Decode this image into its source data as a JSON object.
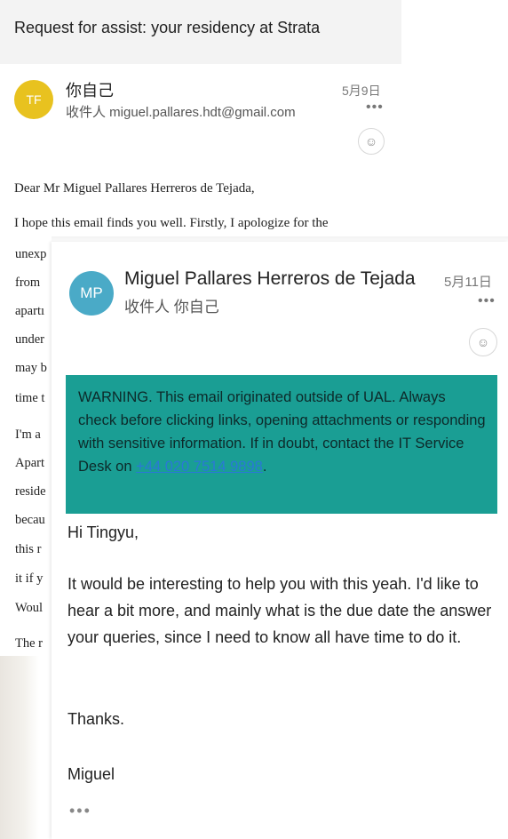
{
  "back_email": {
    "subject": "Request for assist: your residency at Strata",
    "avatar_initials": "TF",
    "sender": "你自己",
    "recipient": "收件人 miguel.pallares.hdt@gmail.com",
    "date": "5月9日",
    "more": "•••",
    "emoji": "☺",
    "greeting": "Dear Mr Miguel Pallares Herreros de Tejada,",
    "line1": "I hope this email finds you well. Firstly, I apologize for the",
    "fragments": [
      "unexp",
      "from",
      "apartı",
      "under",
      "may b",
      "time t",
      "I'm a",
      "Apart",
      "reside",
      "becau",
      "this r",
      "it if y",
      "Woul",
      "The r"
    ]
  },
  "front_email": {
    "avatar_initials": "MP",
    "sender": "Miguel Pallares Herreros de Tejada",
    "recipient": "收件人 你自己",
    "date": "5月11日",
    "more": "•••",
    "emoji": "☺",
    "warning_text": "WARNING. This email originated outside of UAL. Always check before clicking links, opening attachments or responding with sensitive information. If in doubt, contact the IT Service Desk on ",
    "warning_link": "+44 020 7514 9898",
    "warning_end": ".",
    "greeting": "Hi Tingyu,",
    "paragraph": "It would be interesting to help you with this yeah. I'd like to hear a bit more, and mainly what is the due date the answer your queries, since I need to know all have time to do it.",
    "thanks": "Thanks.",
    "signature": "Miguel",
    "trailing_dots": "•••"
  },
  "colors": {
    "tf_avatar": "#e8c21f",
    "mp_avatar": "#4aaac7",
    "warning_bg": "#1a9e94",
    "link": "#2a78d6"
  }
}
